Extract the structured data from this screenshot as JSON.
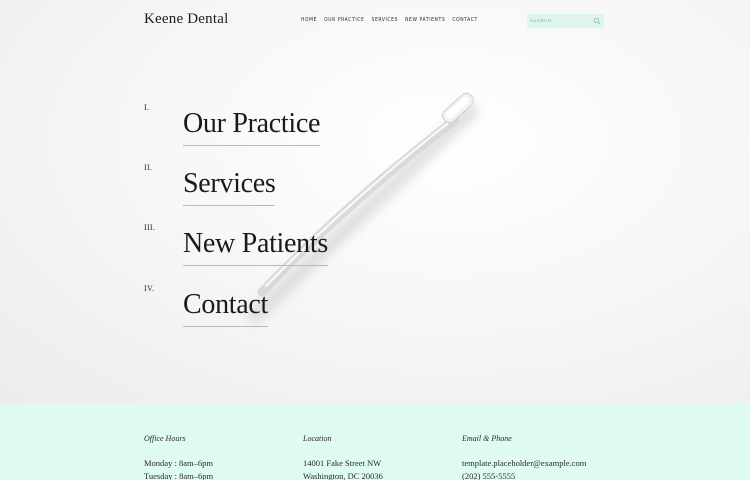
{
  "header": {
    "logo": "Keene Dental",
    "nav": [
      "Home",
      "Our Practice",
      "Services",
      "New Patients",
      "Contact"
    ],
    "search_placeholder": "SEARCH"
  },
  "menu": [
    {
      "numeral": "I.",
      "label": "Our Practice"
    },
    {
      "numeral": "II.",
      "label": "Services"
    },
    {
      "numeral": "III.",
      "label": "New Patients"
    },
    {
      "numeral": "IV.",
      "label": "Contact"
    }
  ],
  "footer": {
    "office_hours": {
      "heading": "Office Hours",
      "lines": [
        "Monday : 8am–6pm",
        "Tuesday : 8am–6pm"
      ]
    },
    "location": {
      "heading": "Location",
      "lines": [
        "14001 Fake Street NW",
        "Washington, DC 20036"
      ]
    },
    "contact": {
      "heading": "Email & Phone",
      "lines": [
        "template.placeholder@example.com",
        "(202) 555-5555"
      ]
    }
  },
  "colors": {
    "accent": "#dffaf1",
    "search_bg": "#dff6ee"
  },
  "icons": [
    "search-icon"
  ],
  "background_image": "toothbrush"
}
